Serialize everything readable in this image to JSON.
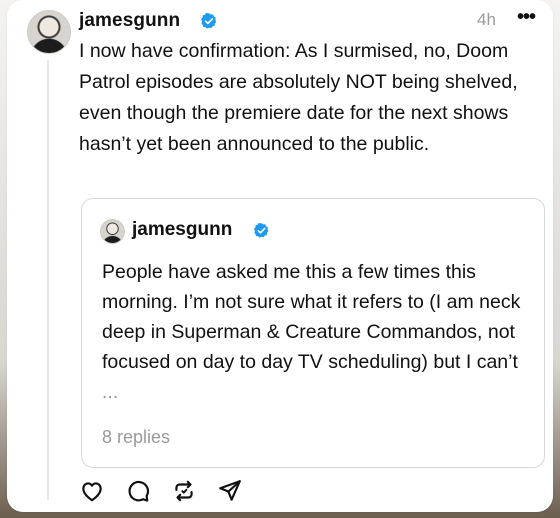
{
  "post": {
    "username": "jamesgunn",
    "verified_icon": "verified-badge-icon",
    "time": "4h",
    "more": "•••",
    "text": "I now have confirmation: As I surmised, no, Doom Patrol episodes are absolutely NOT being shelved, even though the premiere date for the next shows hasn’t yet been announced to the public."
  },
  "quote": {
    "username": "jamesgunn",
    "text": "People have asked me this a few times this morning. I’m not sure what it refers to (I am neck deep in Superman & Creature Commandos, not focused on day to day TV scheduling) but I can’t",
    "ellipsis": "...",
    "replies": "8 replies"
  },
  "actions": [
    "like-icon",
    "comment-icon",
    "repost-icon",
    "share-icon"
  ],
  "colors": {
    "badge_blue": "#1d9bf0",
    "muted_text": "#9a9a9a"
  }
}
